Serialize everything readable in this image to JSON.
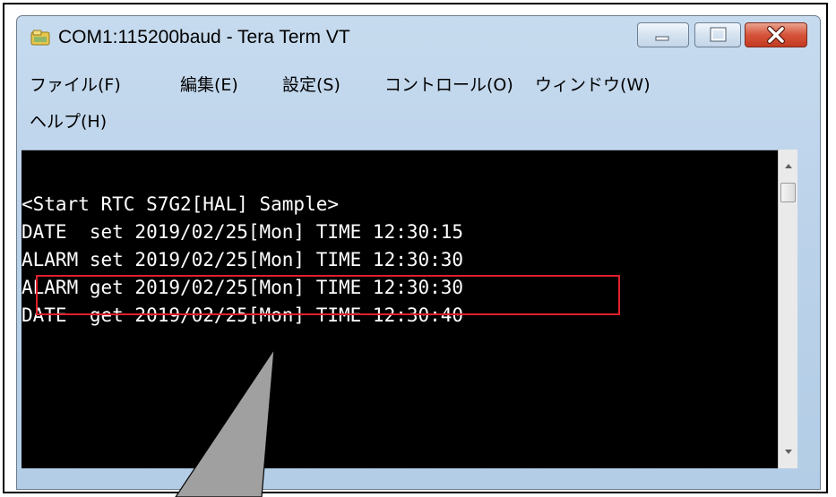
{
  "window": {
    "title": "COM1:115200baud - Tera Term VT",
    "icon": "tera-term-app-icon"
  },
  "caption_buttons": {
    "minimize": "minimize-icon",
    "maximize": "maximize-icon",
    "close": "close-icon"
  },
  "menu": {
    "items": [
      {
        "label": "ファイル(F)"
      },
      {
        "label": "編集(E)"
      },
      {
        "label": "設定(S)"
      },
      {
        "label": "コントロール(O)"
      },
      {
        "label": "ウィンドウ(W)"
      },
      {
        "label": "ヘルプ(H)"
      }
    ]
  },
  "terminal": {
    "lines": [
      "<Start RTC S7G2[HAL] Sample>",
      "DATE  set 2019/02/25[Mon] TIME 12:30:15",
      "ALARM set 2019/02/25[Mon] TIME 12:30:30",
      "ALARM get 2019/02/25[Mon] TIME 12:30:30",
      "DATE  get 2019/02/25[Mon] TIME 12:30:40"
    ],
    "highlighted_line_index": 3
  },
  "colors": {
    "terminal_bg": "#000000",
    "terminal_fg": "#ffffff",
    "highlight": "#e0202a",
    "close_button": "#c9452d",
    "callout_fill": "#a0a0a0"
  }
}
